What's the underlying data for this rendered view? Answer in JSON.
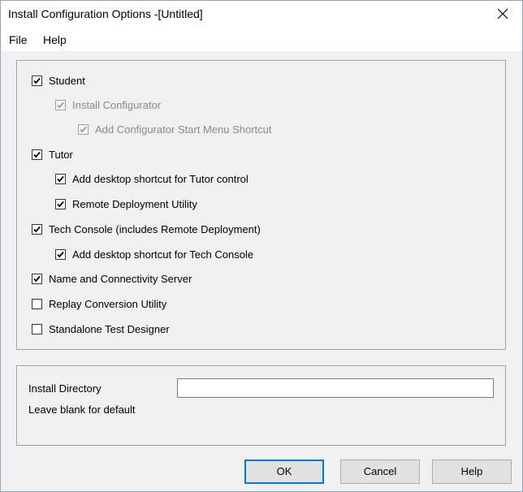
{
  "window": {
    "title": "Install Configuration Options -[Untitled]"
  },
  "menu": {
    "file": "File",
    "help": "Help"
  },
  "options": [
    {
      "label": "Student",
      "checked": true,
      "enabled": true,
      "level": 0
    },
    {
      "label": "Install Configurator",
      "checked": true,
      "enabled": false,
      "level": 1
    },
    {
      "label": "Add Configurator Start Menu Shortcut",
      "checked": true,
      "enabled": false,
      "level": 2
    },
    {
      "label": "Tutor",
      "checked": true,
      "enabled": true,
      "level": 0
    },
    {
      "label": "Add desktop shortcut for Tutor control",
      "checked": true,
      "enabled": true,
      "level": 1
    },
    {
      "label": "Remote Deployment Utility",
      "checked": true,
      "enabled": true,
      "level": 1
    },
    {
      "label": "Tech Console (includes Remote Deployment)",
      "checked": true,
      "enabled": true,
      "level": 0
    },
    {
      "label": "Add desktop shortcut for Tech Console",
      "checked": true,
      "enabled": true,
      "level": 1
    },
    {
      "label": "Name and Connectivity Server",
      "checked": true,
      "enabled": true,
      "level": 0
    },
    {
      "label": "Replay Conversion Utility",
      "checked": false,
      "enabled": true,
      "level": 0
    },
    {
      "label": "Standalone Test Designer",
      "checked": false,
      "enabled": true,
      "level": 0
    }
  ],
  "install_dir": {
    "label": "Install Directory",
    "hint": "Leave blank for default",
    "value": ""
  },
  "buttons": {
    "ok": "OK",
    "cancel": "Cancel",
    "help": "Help"
  }
}
